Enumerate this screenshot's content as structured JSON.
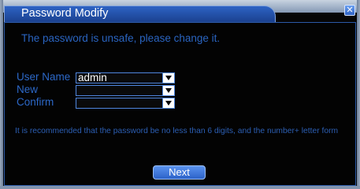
{
  "dialog": {
    "title": "Password Modify",
    "close_icon": "close-icon",
    "warning": "The password is unsafe, please change it.",
    "fields": {
      "user_name": {
        "label": "User Name",
        "value": "admin"
      },
      "new": {
        "label": "New",
        "value": ""
      },
      "confirm": {
        "label": "Confirm",
        "value": ""
      }
    },
    "note": "It is recommended that the password be no less than 6 digits, and the number+ letter form",
    "next_label": "Next"
  },
  "colors": {
    "accent": "#2c68c8",
    "title_bar": "#1f4da6",
    "background": "#030303"
  }
}
